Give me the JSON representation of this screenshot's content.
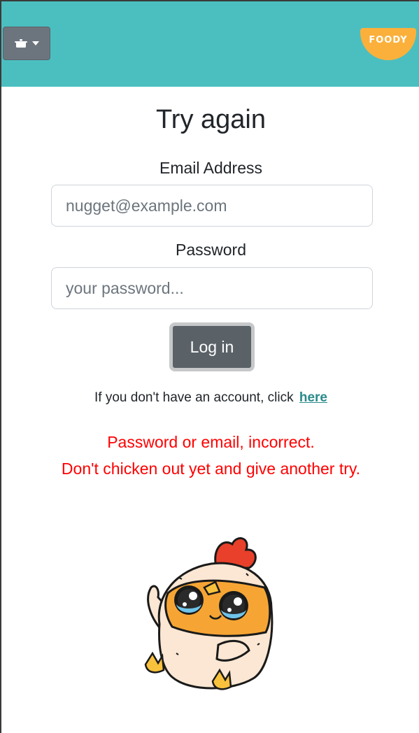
{
  "navbar": {
    "menu_icon": "cooking-pot-icon",
    "menu_caret_icon": "caret-down-icon",
    "logo_text": "FOODY",
    "color": "#4bbfc0",
    "logo_color": "#fbb03b"
  },
  "form": {
    "title": "Try again",
    "email_label": "Email Address",
    "email_placeholder": "nugget@example.com",
    "email_value": "",
    "password_label": "Password",
    "password_placeholder": "your password...",
    "password_value": "",
    "login_label": "Log in",
    "signup_prompt": "If you don't have an account, click",
    "signup_link": "here"
  },
  "error": {
    "line1": "Password or email, incorrect.",
    "line2": "Don't chicken out yet and give another try.",
    "color": "#ff0000"
  },
  "mascot": {
    "icon": "crying-chicken-nugget-illustration"
  }
}
